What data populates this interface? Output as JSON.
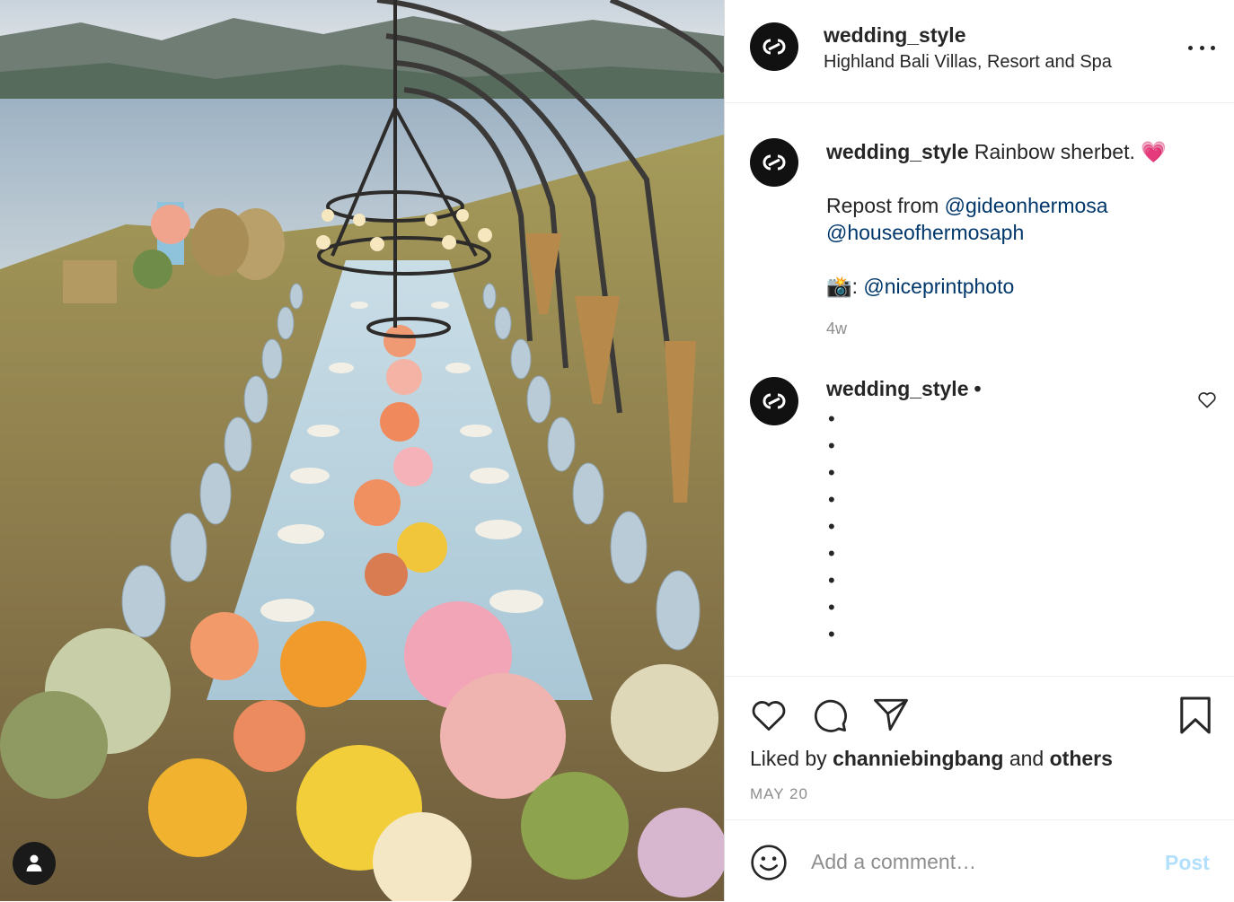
{
  "header": {
    "username": "wedding_style",
    "location": "Highland Bali Villas, Resort and Spa",
    "more_icon": "more-horizontal-icon"
  },
  "caption": {
    "username": "wedding_style",
    "text": "Rainbow sherbet.",
    "emoji": "💗",
    "repost_prefix": "Repost from",
    "mention_1": "@gideonhermosa",
    "mention_2": "@houseofhermosaph",
    "camera_emoji": "📸",
    "camera_sep": ":",
    "mention_3": "@niceprintphoto",
    "time": "4w"
  },
  "comment": {
    "username": "wedding_style",
    "separator": "•",
    "lines": [
      "•",
      "•",
      "•",
      "•",
      "•",
      "•",
      "•",
      "•",
      "•"
    ]
  },
  "actions": {
    "liked_prefix": "Liked by",
    "liked_user": "channiebingbang",
    "liked_and": "and",
    "liked_others": "others",
    "date": "MAY 20"
  },
  "add_comment": {
    "placeholder": "Add a comment…",
    "post_label": "Post"
  },
  "colors": {
    "link": "#00376b",
    "post_disabled": "#b2dffc",
    "muted": "#8e8e8e",
    "text": "#262626"
  }
}
